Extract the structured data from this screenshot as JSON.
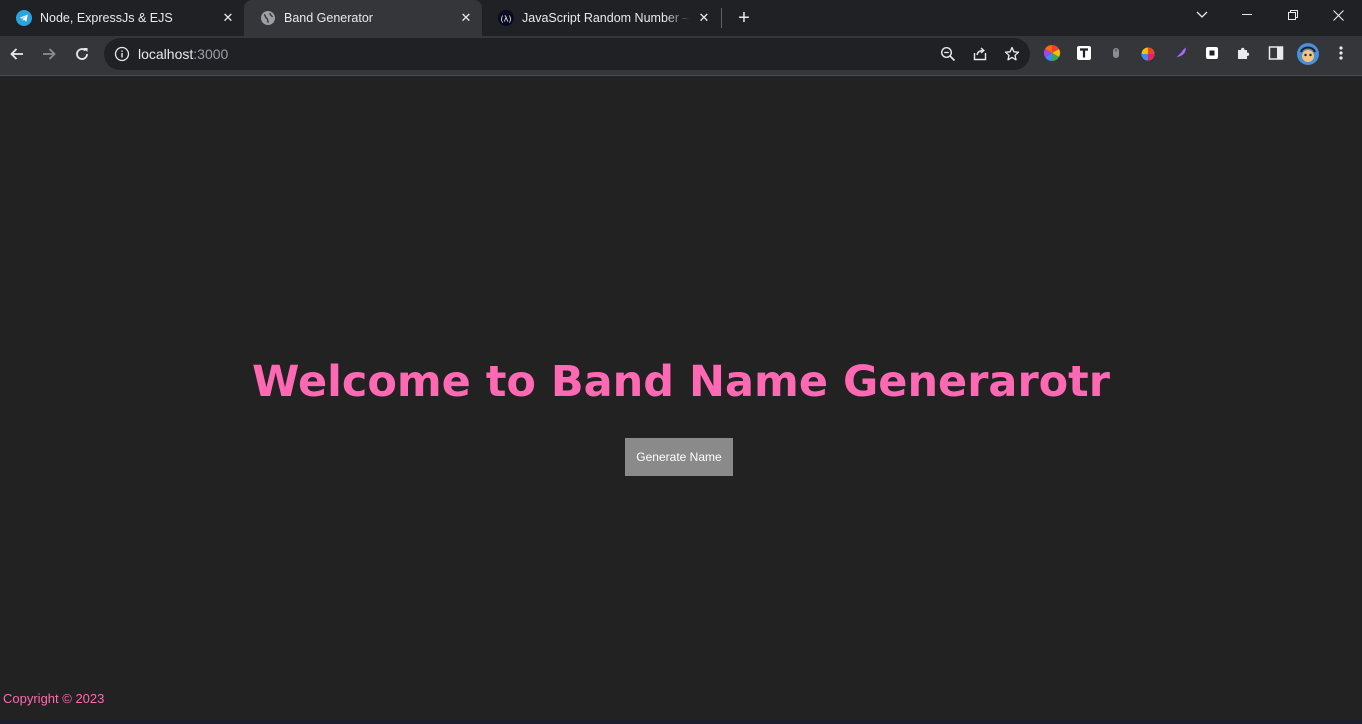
{
  "browser": {
    "tabs": [
      {
        "title": "Node, ExpressJs & EJS",
        "icon": "telegram-icon",
        "active": false
      },
      {
        "title": "Band Generator",
        "icon": "globe-icon",
        "active": true
      },
      {
        "title": "JavaScript Random Number – How to Generate a Random Number in JavaScript",
        "icon": "freecodecamp-icon",
        "active": false
      }
    ],
    "address": {
      "host": "localhost",
      "port": ":3000"
    }
  },
  "page": {
    "heading": "Welcome to Band Name Generarotr",
    "button_label": "Generate Name",
    "footer": "Copyright © 2023"
  },
  "colors": {
    "accent": "#ff69b4",
    "background": "#222222",
    "button": "#8a8a8a"
  }
}
